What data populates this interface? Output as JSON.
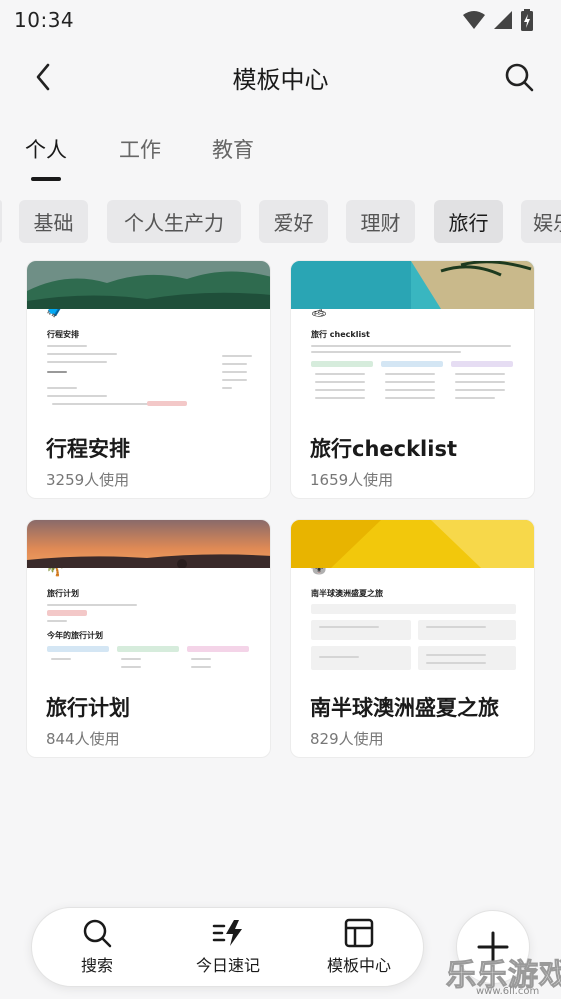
{
  "status": {
    "time": "10:34"
  },
  "header": {
    "title": "模板中心"
  },
  "tabs": [
    {
      "label": "个人"
    },
    {
      "label": "工作"
    },
    {
      "label": "教育"
    }
  ],
  "chips": [
    {
      "label": "基础"
    },
    {
      "label": "个人生产力"
    },
    {
      "label": "爱好"
    },
    {
      "label": "理财"
    },
    {
      "label": "旅行"
    },
    {
      "label": "娱乐"
    }
  ],
  "cards": [
    {
      "title": "行程安排",
      "usage": "3259人使用",
      "preview_title": "行程安排",
      "cover_color": "#2f6b4f",
      "emoji": "🧳"
    },
    {
      "title": "旅行checklist",
      "usage": "1659人使用",
      "preview_title": "旅行 checklist",
      "cover_color": "#39b6c0",
      "emoji": "🏝"
    },
    {
      "title": "旅行计划",
      "usage": "844人使用",
      "preview_title": "旅行计划",
      "preview_subtitle": "今年的旅行计划",
      "cover_color": "#c46a43",
      "emoji": "🌴"
    },
    {
      "title": "南半球澳洲盛夏之旅",
      "usage": "829人使用",
      "preview_title": "南半球澳洲盛夏之旅",
      "cover_color": "#f2c80c",
      "emoji": "🐨"
    }
  ],
  "bottom_nav": {
    "items": [
      {
        "label": "搜索",
        "icon": "search-icon"
      },
      {
        "label": "今日速记",
        "icon": "quick-note-icon"
      },
      {
        "label": "模板中心",
        "icon": "template-icon"
      }
    ],
    "fab_icon": "plus-icon"
  },
  "watermark": {
    "text": "乐乐游戏",
    "url": "www.6ll.com"
  },
  "colors": {
    "background": "#f6f6f7",
    "card": "#ffffff",
    "chip": "#e8e8ea",
    "text": "#1a1a1a",
    "muted": "#777777"
  }
}
